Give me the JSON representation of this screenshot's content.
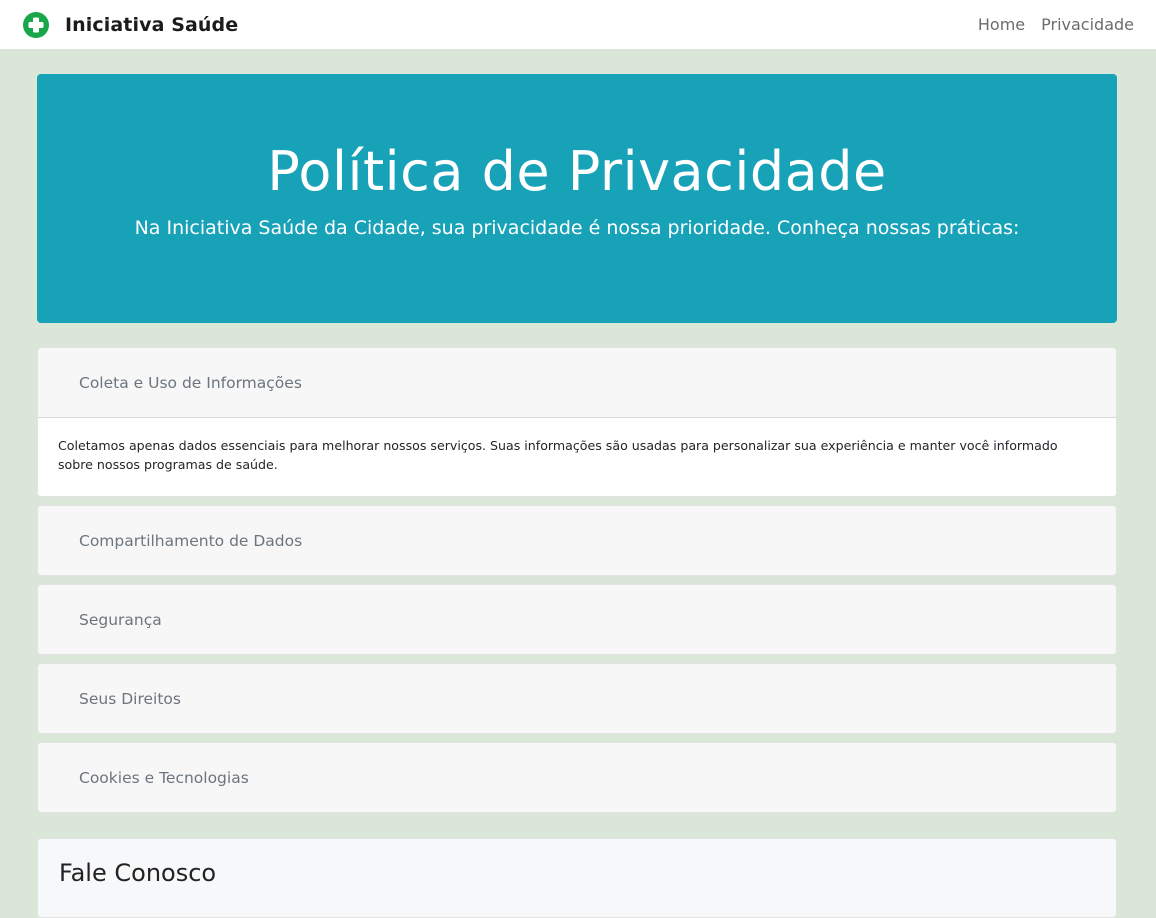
{
  "navbar": {
    "brand": "Iniciativa Saúde",
    "brand_icon": "green-cross-icon",
    "brand_color": "#1aa64a",
    "links": [
      {
        "label": "Home"
      },
      {
        "label": "Privacidade"
      }
    ]
  },
  "hero": {
    "title": "Política de Privacidade",
    "subtitle": "Na Iniciativa Saúde da Cidade, sua privacidade é nossa prioridade. Conheça nossas práticas:",
    "background": "#17a2b8"
  },
  "accordion": {
    "items": [
      {
        "title": "Coleta e Uso de Informações",
        "expanded": true,
        "body": "Coletamos apenas dados essenciais para melhorar nossos serviços. Suas informações são usadas para personalizar sua experiência e manter você informado sobre nossos programas de saúde."
      },
      {
        "title": "Compartilhamento de Dados",
        "expanded": false
      },
      {
        "title": "Segurança",
        "expanded": false
      },
      {
        "title": "Seus Direitos",
        "expanded": false
      },
      {
        "title": "Cookies e Tecnologias",
        "expanded": false
      }
    ]
  },
  "contact": {
    "title": "Fale Conosco"
  },
  "colors": {
    "page_background": "#dae7d8",
    "accent": "#17a2b8"
  }
}
